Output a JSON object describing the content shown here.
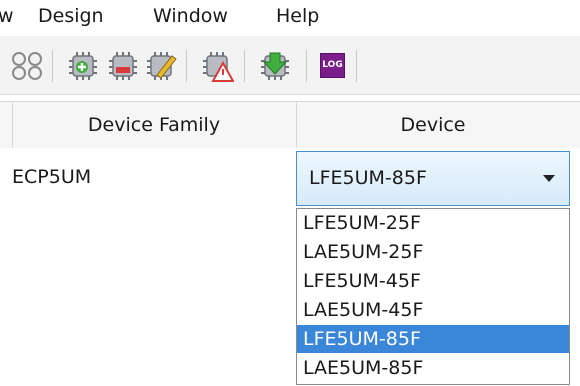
{
  "menu": {
    "partial_left": "w",
    "items": [
      "Design",
      "Window",
      "Help"
    ]
  },
  "toolbar": {
    "icons": [
      "network-icon",
      "add-chip-icon",
      "remove-chip-icon",
      "edit-chip-icon",
      "warning-chip-icon",
      "download-chip-icon"
    ],
    "log_label": "LOG"
  },
  "table": {
    "headers": [
      "Device Family",
      "Device"
    ],
    "row": {
      "family": "ECP5UM"
    }
  },
  "device_select": {
    "selected": "LFE5UM-85F",
    "options": [
      "LFE5UM-25F",
      "LAE5UM-25F",
      "LFE5UM-45F",
      "LAE5UM-45F",
      "LFE5UM-85F",
      "LAE5UM-85F"
    ],
    "highlighted_option": "LFE5UM-85F"
  }
}
